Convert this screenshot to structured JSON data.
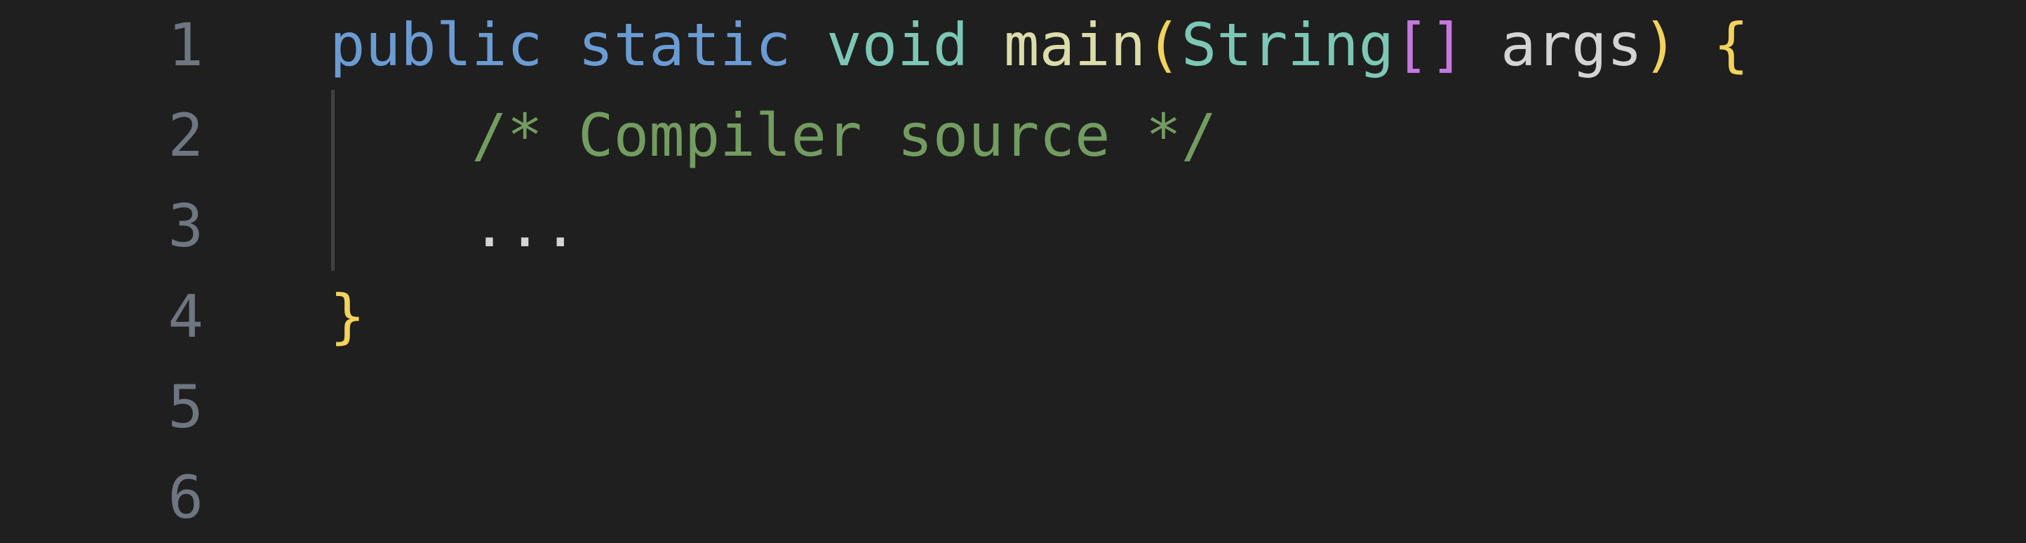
{
  "editor": {
    "colors": {
      "background": "#1f1f1f",
      "line_number": "#6e7681",
      "keyword": "#6b9bd3",
      "type": "#7cc7b5",
      "function": "#dcdcaa",
      "paren": "#f2d35b",
      "bracket": "#c678dd",
      "plain": "#d4d4d4",
      "comment": "#739c60"
    },
    "lines": [
      {
        "number": "1",
        "tokens": [
          {
            "text": "public",
            "kind": "keyword"
          },
          {
            "text": " ",
            "kind": "plain"
          },
          {
            "text": "static",
            "kind": "keyword"
          },
          {
            "text": " ",
            "kind": "plain"
          },
          {
            "text": "void",
            "kind": "type"
          },
          {
            "text": " ",
            "kind": "plain"
          },
          {
            "text": "main",
            "kind": "function"
          },
          {
            "text": "(",
            "kind": "paren"
          },
          {
            "text": "String",
            "kind": "type"
          },
          {
            "text": "[]",
            "kind": "bracket"
          },
          {
            "text": " ",
            "kind": "plain"
          },
          {
            "text": "args",
            "kind": "plain"
          },
          {
            "text": ")",
            "kind": "paren"
          },
          {
            "text": " ",
            "kind": "plain"
          },
          {
            "text": "{",
            "kind": "paren"
          }
        ]
      },
      {
        "number": "2",
        "tokens": [
          {
            "text": "    ",
            "kind": "plain"
          },
          {
            "text": "/* Compiler source */",
            "kind": "comment"
          }
        ]
      },
      {
        "number": "3",
        "tokens": [
          {
            "text": "    ",
            "kind": "plain"
          },
          {
            "text": "...",
            "kind": "plain"
          }
        ]
      },
      {
        "number": "4",
        "tokens": [
          {
            "text": "}",
            "kind": "paren"
          }
        ]
      },
      {
        "number": "5",
        "tokens": []
      },
      {
        "number": "6",
        "tokens": []
      }
    ]
  }
}
